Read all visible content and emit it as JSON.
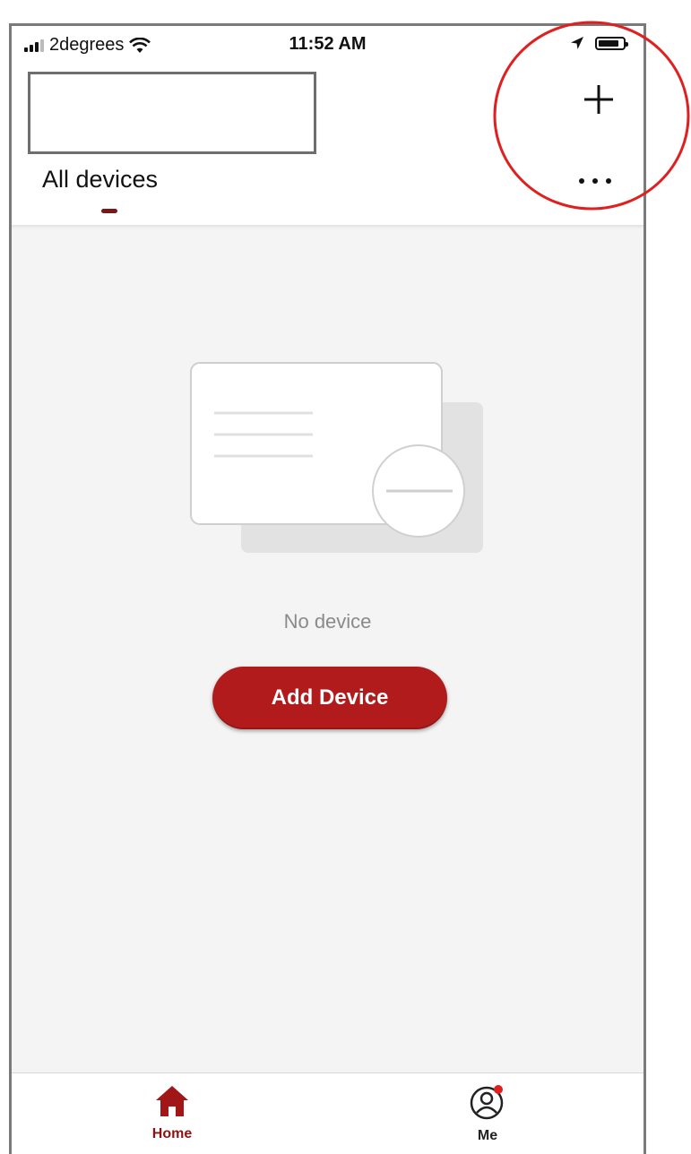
{
  "status_bar": {
    "carrier": "2degrees",
    "time": "11:52 AM",
    "battery_level": 0.85,
    "icons": [
      "signal-icon",
      "wifi-icon",
      "location-arrow-icon",
      "battery-icon"
    ]
  },
  "header": {
    "tabs": [
      {
        "label": "All devices",
        "selected": true
      }
    ],
    "actions": [
      "plus-icon",
      "more-icon"
    ]
  },
  "empty_state": {
    "message": "No device",
    "button_label": "Add Device"
  },
  "tab_bar": {
    "items": [
      {
        "label": "Home",
        "icon": "home-icon",
        "selected": true
      },
      {
        "label": "Me",
        "icon": "user-icon",
        "badge": true
      }
    ]
  },
  "colors": {
    "accent": "#b21b1b",
    "annotation": "#e02020"
  }
}
